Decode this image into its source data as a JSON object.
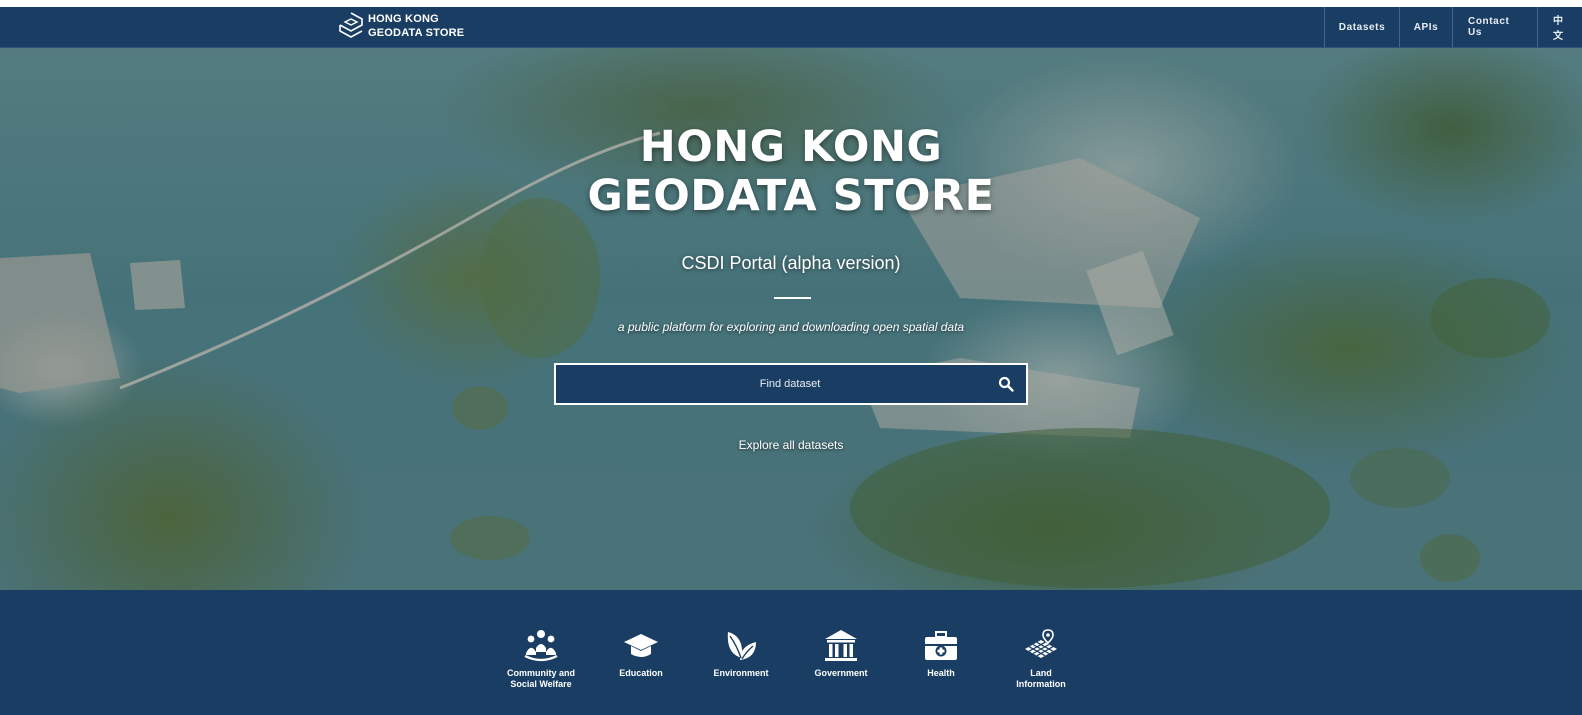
{
  "brand": {
    "line1": "HONG KONG",
    "line2": "GEODATA STORE",
    "logo_icon": "hexagon-logo-icon"
  },
  "nav": [
    {
      "label": "Datasets"
    },
    {
      "label": "APIs"
    },
    {
      "label": "Contact Us"
    },
    {
      "label": "中文"
    }
  ],
  "hero": {
    "title_line1": "HONG KONG",
    "title_line2": "GEODATA STORE",
    "subtitle": "CSDI Portal (alpha version)",
    "tagline": "a public platform for exploring and downloading open spatial data",
    "search_placeholder": "Find dataset",
    "search_icon": "search-icon",
    "explore_label": "Explore all datasets"
  },
  "categories": [
    {
      "label": "Community and Social Welfare",
      "icon": "community-icon"
    },
    {
      "label": "Education",
      "icon": "mortarboard-icon"
    },
    {
      "label": "Environment",
      "icon": "leaves-icon"
    },
    {
      "label": "Government",
      "icon": "government-building-icon"
    },
    {
      "label": "Health",
      "icon": "first-aid-kit-icon"
    },
    {
      "label": "Land Information",
      "icon": "map-grid-pin-icon"
    }
  ],
  "colors": {
    "primary": "#1a3e63",
    "text": "#ffffff"
  }
}
